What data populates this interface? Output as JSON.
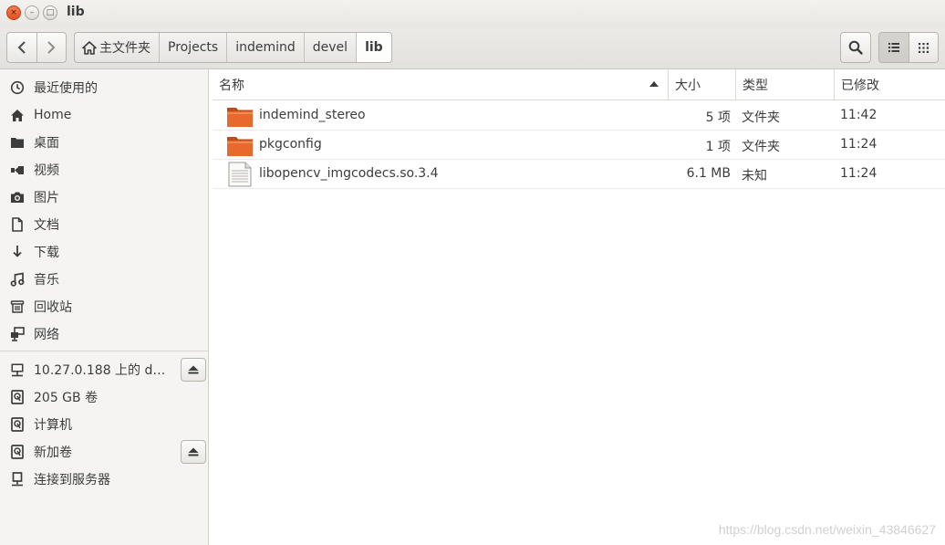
{
  "window": {
    "title": "lib",
    "close_glyph": "×",
    "min_glyph": "–",
    "max_glyph": "□"
  },
  "toolbar": {
    "back_icon": "chevron-left-icon",
    "forward_icon": "chevron-right-icon",
    "breadcrumbs": [
      "主文件夹",
      "Projects",
      "indemind",
      "devel",
      "lib"
    ],
    "search_icon": "search-icon",
    "list_view_icon": "list-view-icon",
    "grid_view_icon": "grid-view-icon"
  },
  "sidebar": {
    "places": [
      {
        "label": "最近使用的",
        "icon": "clock-icon"
      },
      {
        "label": "Home",
        "icon": "home-icon"
      },
      {
        "label": "桌面",
        "icon": "folder-icon"
      },
      {
        "label": "视频",
        "icon": "video-icon"
      },
      {
        "label": "图片",
        "icon": "camera-icon"
      },
      {
        "label": "文档",
        "icon": "document-icon"
      },
      {
        "label": "下载",
        "icon": "download-icon"
      },
      {
        "label": "音乐",
        "icon": "music-icon"
      },
      {
        "label": "回收站",
        "icon": "trash-icon"
      },
      {
        "label": "网络",
        "icon": "network-icon"
      }
    ],
    "devices": [
      {
        "label": "10.27.0.188 上的 dat...",
        "icon": "network-drive-icon",
        "eject": true
      },
      {
        "label": "205 GB 卷",
        "icon": "drive-icon",
        "eject": false
      },
      {
        "label": "计算机",
        "icon": "drive-icon",
        "eject": false
      },
      {
        "label": "新加卷",
        "icon": "drive-icon",
        "eject": true
      },
      {
        "label": "连接到服务器",
        "icon": "server-icon",
        "eject": false
      }
    ]
  },
  "file_list": {
    "columns": {
      "name": "名称",
      "size": "大小",
      "type": "类型",
      "modified": "已修改"
    },
    "sort_icon": "sort-ascending-icon",
    "rows": [
      {
        "name": "indemind_stereo",
        "size": "5 项",
        "type": "文件夹",
        "modified": "11:42",
        "kind": "folder"
      },
      {
        "name": "pkgconfig",
        "size": "1 项",
        "type": "文件夹",
        "modified": "11:24",
        "kind": "folder"
      },
      {
        "name": "libopencv_imgcodecs.so.3.4",
        "size": "6.1 MB",
        "type": "未知",
        "modified": "11:24",
        "kind": "file"
      }
    ]
  },
  "watermark": "https://blog.csdn.net/weixin_43846627",
  "colors": {
    "folder_orange": "#e2622a",
    "close_button": "#e0521f",
    "sidebar_bg": "#f5f4f3"
  }
}
